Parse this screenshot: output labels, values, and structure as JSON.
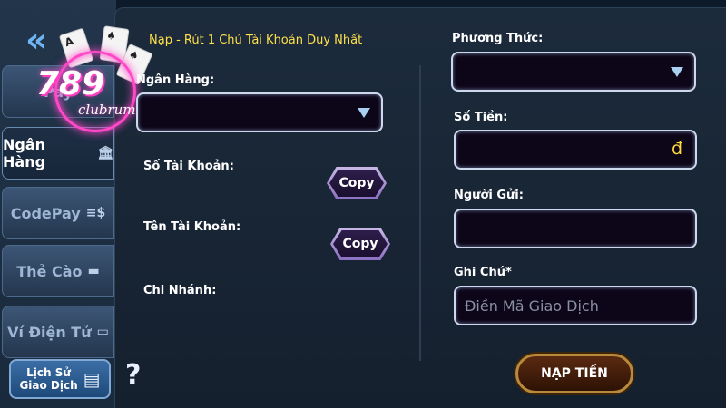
{
  "nav": {
    "tabs": [
      {
        "label": "Pay",
        "icon": "pay-icon"
      },
      {
        "label": "Ngân Hàng",
        "icon": "bank-icon"
      },
      {
        "label": "CodePay",
        "icon": "coin-icon"
      },
      {
        "label": "Thẻ Cào",
        "icon": "card-icon"
      },
      {
        "label": "Ví Điện Tử",
        "icon": "wallet-icon"
      }
    ],
    "history_label_1": "Lịch Sử",
    "history_label_2": "Giao Dịch",
    "help_label": "?"
  },
  "logo": {
    "number": "789",
    "club": "clubrum"
  },
  "form_left": {
    "notice": "Nạp - Rút 1 Chủ Tài Khoản Duy Nhất",
    "bank_label": "Ngân Hàng:",
    "account_number_label": "Số Tài Khoản:",
    "account_name_label": "Tên Tài Khoản:",
    "branch_label": "Chi Nhánh:",
    "copy_label": "Copy"
  },
  "form_right": {
    "method_label": "Phương Thức:",
    "amount_label": "Số Tiền:",
    "amount_currency": "đ",
    "sender_label": "Người Gửi:",
    "note_label": "Ghi Chú*",
    "note_placeholder": "Điền Mã Giao Dịch",
    "submit_label": "NẠP TIỀN"
  },
  "colors": {
    "notice": "#ffe14a",
    "currency": "#ffd83a",
    "field_border": "#cdd8ee",
    "field_bg": "#0d0518"
  }
}
